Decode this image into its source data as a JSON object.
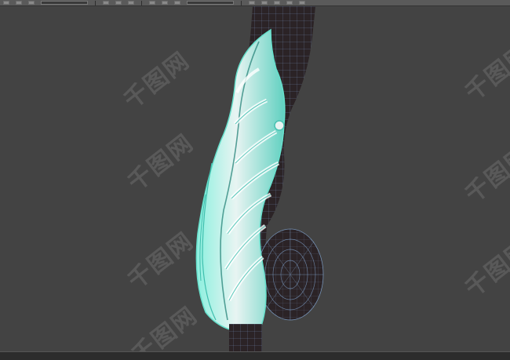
{
  "toolbar": {
    "icons": [
      "select-icon",
      "fence-icon",
      "crossing-icon",
      "window-icon",
      "rotate-icon",
      "scale-icon",
      "link-icon",
      "undo-icon",
      "redo-icon",
      "render-icon",
      "render-frame-icon",
      "layer-icon",
      "camera-icon",
      "settings-icon"
    ]
  },
  "viewport": {
    "background_color": "#434343",
    "model_color": "#2b2326",
    "wire_color": "#8fb8e8",
    "leaf_highlight_color": "#7fe6d6"
  },
  "watermark": {
    "text": "千图网"
  }
}
